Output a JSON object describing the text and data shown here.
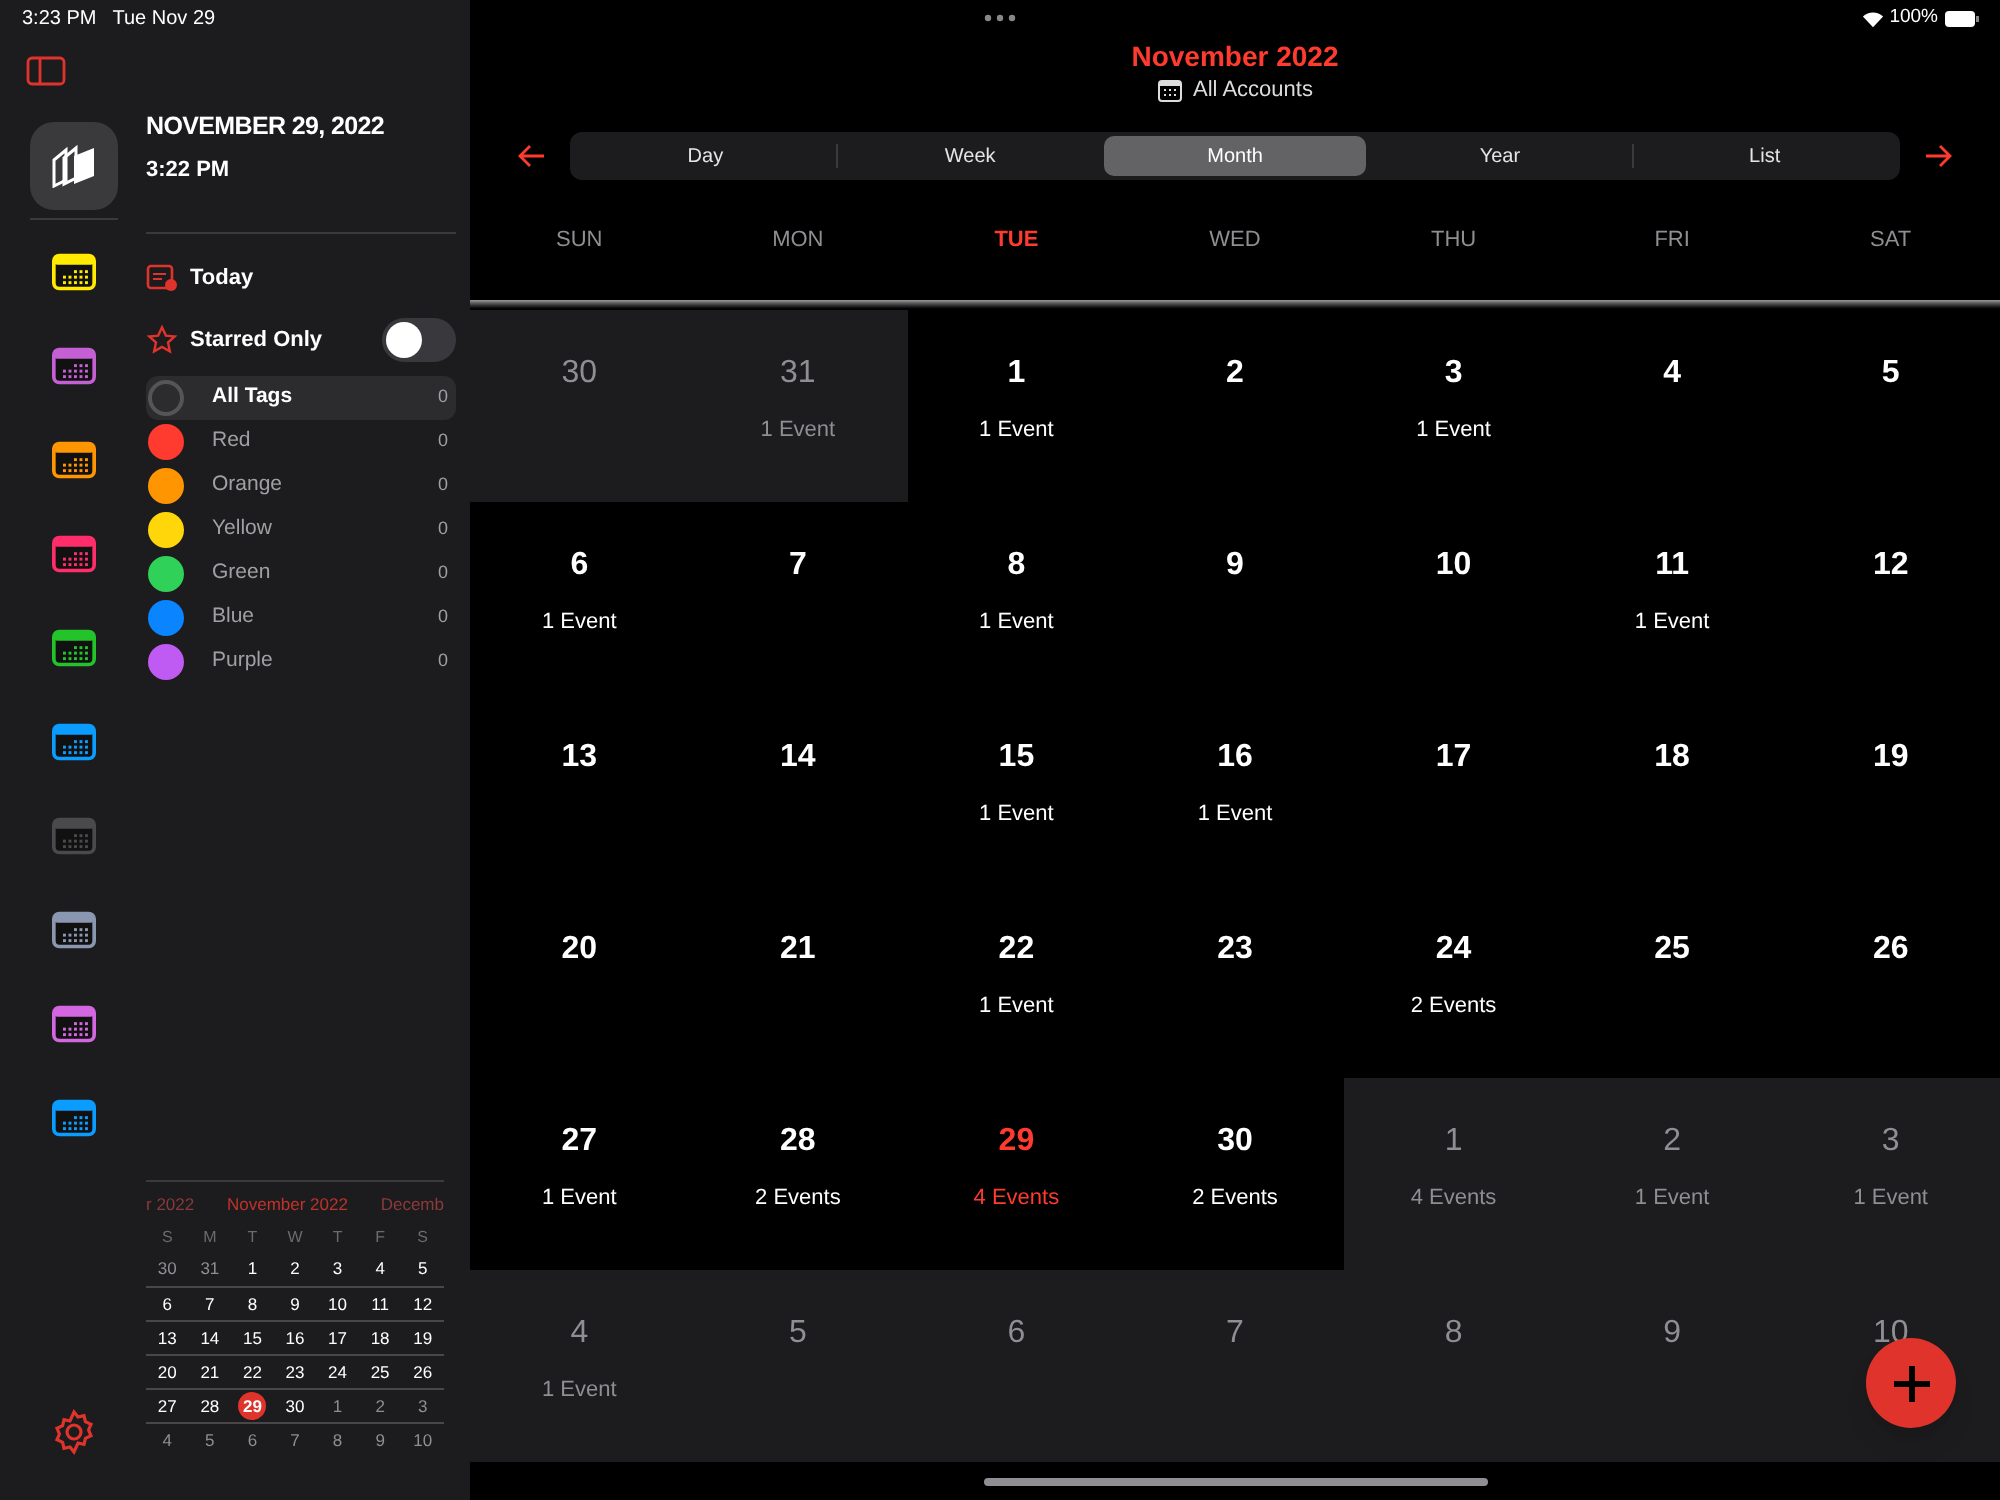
{
  "status_bar": {
    "time": "3:23 PM",
    "date": "Tue Nov 29",
    "battery": "100%"
  },
  "sidebar": {
    "header": {
      "date": "NOVEMBER 29, 2022",
      "time": "3:22 PM"
    },
    "calendars": [
      {
        "color": "#ffea00"
      },
      {
        "color": "#c45fd4"
      },
      {
        "color": "#ff9500"
      },
      {
        "color": "#ff2d6a"
      },
      {
        "color": "#22c42a"
      },
      {
        "color": "#0a9dff"
      },
      {
        "color": "#4a4a4c"
      },
      {
        "color": "#8a97b0"
      },
      {
        "color": "#d466e2"
      },
      {
        "color": "#0a9dff"
      }
    ],
    "today": "Today",
    "starred_only": {
      "label": "Starred Only",
      "on": false
    },
    "tags": [
      {
        "kind": "all",
        "name": "All Tags",
        "count": "0",
        "selected": true
      },
      {
        "kind": "color",
        "name": "Red",
        "count": "0",
        "color": "#ff3b30",
        "selected": false
      },
      {
        "kind": "color",
        "name": "Orange",
        "count": "0",
        "color": "#ff9500",
        "selected": false
      },
      {
        "kind": "color",
        "name": "Yellow",
        "count": "0",
        "color": "#ffd60a",
        "selected": false
      },
      {
        "kind": "color",
        "name": "Green",
        "count": "0",
        "color": "#30d158",
        "selected": false
      },
      {
        "kind": "color",
        "name": "Blue",
        "count": "0",
        "color": "#0a84ff",
        "selected": false
      },
      {
        "kind": "color",
        "name": "Purple",
        "count": "0",
        "color": "#bf5af2",
        "selected": false
      }
    ],
    "mini_calendar": {
      "prev": "r 2022",
      "month": "November 2022",
      "next": "Decemb",
      "weekdays": [
        "S",
        "M",
        "T",
        "W",
        "T",
        "F",
        "S"
      ],
      "weeks": [
        [
          {
            "day": "30",
            "in_month": false,
            "today": false
          },
          {
            "day": "31",
            "in_month": false,
            "today": false
          },
          {
            "day": "1",
            "in_month": true,
            "today": false
          },
          {
            "day": "2",
            "in_month": true,
            "today": false
          },
          {
            "day": "3",
            "in_month": true,
            "today": false
          },
          {
            "day": "4",
            "in_month": true,
            "today": false
          },
          {
            "day": "5",
            "in_month": true,
            "today": false
          }
        ],
        [
          {
            "day": "6",
            "in_month": true,
            "today": false
          },
          {
            "day": "7",
            "in_month": true,
            "today": false
          },
          {
            "day": "8",
            "in_month": true,
            "today": false
          },
          {
            "day": "9",
            "in_month": true,
            "today": false
          },
          {
            "day": "10",
            "in_month": true,
            "today": false
          },
          {
            "day": "11",
            "in_month": true,
            "today": false
          },
          {
            "day": "12",
            "in_month": true,
            "today": false
          }
        ],
        [
          {
            "day": "13",
            "in_month": true,
            "today": false
          },
          {
            "day": "14",
            "in_month": true,
            "today": false
          },
          {
            "day": "15",
            "in_month": true,
            "today": false
          },
          {
            "day": "16",
            "in_month": true,
            "today": false
          },
          {
            "day": "17",
            "in_month": true,
            "today": false
          },
          {
            "day": "18",
            "in_month": true,
            "today": false
          },
          {
            "day": "19",
            "in_month": true,
            "today": false
          }
        ],
        [
          {
            "day": "20",
            "in_month": true,
            "today": false
          },
          {
            "day": "21",
            "in_month": true,
            "today": false
          },
          {
            "day": "22",
            "in_month": true,
            "today": false
          },
          {
            "day": "23",
            "in_month": true,
            "today": false
          },
          {
            "day": "24",
            "in_month": true,
            "today": false
          },
          {
            "day": "25",
            "in_month": true,
            "today": false
          },
          {
            "day": "26",
            "in_month": true,
            "today": false
          }
        ],
        [
          {
            "day": "27",
            "in_month": true,
            "today": false
          },
          {
            "day": "28",
            "in_month": true,
            "today": false
          },
          {
            "day": "29",
            "in_month": true,
            "today": true
          },
          {
            "day": "30",
            "in_month": true,
            "today": false
          },
          {
            "day": "1",
            "in_month": false,
            "today": false
          },
          {
            "day": "2",
            "in_month": false,
            "today": false
          },
          {
            "day": "3",
            "in_month": false,
            "today": false
          }
        ],
        [
          {
            "day": "4",
            "in_month": false,
            "today": false
          },
          {
            "day": "5",
            "in_month": false,
            "today": false
          },
          {
            "day": "6",
            "in_month": false,
            "today": false
          },
          {
            "day": "7",
            "in_month": false,
            "today": false
          },
          {
            "day": "8",
            "in_month": false,
            "today": false
          },
          {
            "day": "9",
            "in_month": false,
            "today": false
          },
          {
            "day": "10",
            "in_month": false,
            "today": false
          }
        ]
      ]
    }
  },
  "header": {
    "title": "November 2022",
    "account": "All Accounts"
  },
  "view_tabs": [
    {
      "label": "Day",
      "selected": false
    },
    {
      "label": "Week",
      "selected": false
    },
    {
      "label": "Month",
      "selected": true
    },
    {
      "label": "Year",
      "selected": false
    },
    {
      "label": "List",
      "selected": false
    }
  ],
  "weekdays": [
    {
      "label": "SUN",
      "today": false
    },
    {
      "label": "MON",
      "today": false
    },
    {
      "label": "TUE",
      "today": true
    },
    {
      "label": "WED",
      "today": false
    },
    {
      "label": "THU",
      "today": false
    },
    {
      "label": "FRI",
      "today": false
    },
    {
      "label": "SAT",
      "today": false
    }
  ],
  "month_grid": [
    [
      {
        "day": "30",
        "in_month": false,
        "today": false
      },
      {
        "day": "31",
        "events": "1 Event",
        "in_month": false,
        "today": false
      },
      {
        "day": "1",
        "events": "1 Event",
        "in_month": true,
        "today": false
      },
      {
        "day": "2",
        "in_month": true,
        "today": false
      },
      {
        "day": "3",
        "events": "1 Event",
        "in_month": true,
        "today": false
      },
      {
        "day": "4",
        "in_month": true,
        "today": false
      },
      {
        "day": "5",
        "in_month": true,
        "today": false
      }
    ],
    [
      {
        "day": "6",
        "events": "1 Event",
        "in_month": true,
        "today": false
      },
      {
        "day": "7",
        "in_month": true,
        "today": false
      },
      {
        "day": "8",
        "events": "1 Event",
        "in_month": true,
        "today": false
      },
      {
        "day": "9",
        "in_month": true,
        "today": false
      },
      {
        "day": "10",
        "in_month": true,
        "today": false
      },
      {
        "day": "11",
        "events": "1 Event",
        "in_month": true,
        "today": false
      },
      {
        "day": "12",
        "in_month": true,
        "today": false
      }
    ],
    [
      {
        "day": "13",
        "in_month": true,
        "today": false
      },
      {
        "day": "14",
        "in_month": true,
        "today": false
      },
      {
        "day": "15",
        "events": "1 Event",
        "in_month": true,
        "today": false
      },
      {
        "day": "16",
        "events": "1 Event",
        "in_month": true,
        "today": false
      },
      {
        "day": "17",
        "in_month": true,
        "today": false
      },
      {
        "day": "18",
        "in_month": true,
        "today": false
      },
      {
        "day": "19",
        "in_month": true,
        "today": false
      }
    ],
    [
      {
        "day": "20",
        "in_month": true,
        "today": false
      },
      {
        "day": "21",
        "in_month": true,
        "today": false
      },
      {
        "day": "22",
        "events": "1 Event",
        "in_month": true,
        "today": false
      },
      {
        "day": "23",
        "in_month": true,
        "today": false
      },
      {
        "day": "24",
        "events": "2 Events",
        "in_month": true,
        "today": false
      },
      {
        "day": "25",
        "in_month": true,
        "today": false
      },
      {
        "day": "26",
        "in_month": true,
        "today": false
      }
    ],
    [
      {
        "day": "27",
        "events": "1 Event",
        "in_month": true,
        "today": false
      },
      {
        "day": "28",
        "events": "2 Events",
        "in_month": true,
        "today": false
      },
      {
        "day": "29",
        "events": "4 Events",
        "in_month": true,
        "today": true
      },
      {
        "day": "30",
        "events": "2 Events",
        "in_month": true,
        "today": false
      },
      {
        "day": "1",
        "events": "4 Events",
        "in_month": false,
        "today": false
      },
      {
        "day": "2",
        "events": "1 Event",
        "in_month": false,
        "today": false
      },
      {
        "day": "3",
        "events": "1 Event",
        "in_month": false,
        "today": false
      }
    ],
    [
      {
        "day": "4",
        "events": "1 Event",
        "in_month": false,
        "today": false
      },
      {
        "day": "5",
        "in_month": false,
        "today": false
      },
      {
        "day": "6",
        "in_month": false,
        "today": false
      },
      {
        "day": "7",
        "in_month": false,
        "today": false
      },
      {
        "day": "8",
        "in_month": false,
        "today": false
      },
      {
        "day": "9",
        "in_month": false,
        "today": false
      },
      {
        "day": "10",
        "in_month": false,
        "today": false
      }
    ]
  ]
}
